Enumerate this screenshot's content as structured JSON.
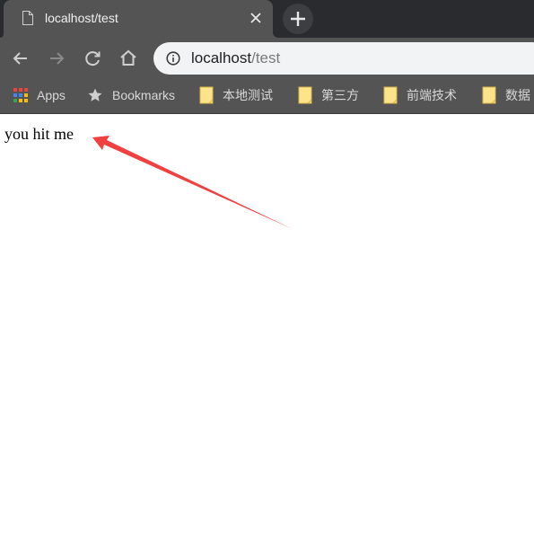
{
  "browser": {
    "tab": {
      "title": "localhost/test",
      "favicon": "page-icon",
      "close_icon": "close-icon"
    },
    "new_tab_icon": "plus-icon",
    "toolbar": {
      "back_icon": "arrow-left-icon",
      "forward_icon": "arrow-right-icon",
      "reload_icon": "reload-icon",
      "home_icon": "home-icon"
    },
    "omnibox": {
      "info_icon": "info-icon",
      "host": "localhost",
      "path": "/test"
    },
    "bookmarks": [
      {
        "label": "Apps",
        "icon": "apps-grid-icon"
      },
      {
        "label": "Bookmarks",
        "icon": "star-icon"
      },
      {
        "label": "本地测试",
        "icon": "folder-icon"
      },
      {
        "label": "第三方",
        "icon": "folder-icon"
      },
      {
        "label": "前端技术",
        "icon": "folder-icon"
      },
      {
        "label": "数据",
        "icon": "folder-icon"
      }
    ]
  },
  "page": {
    "text": "you hit me",
    "annotation": {
      "type": "arrow",
      "color": "#f04040"
    }
  }
}
